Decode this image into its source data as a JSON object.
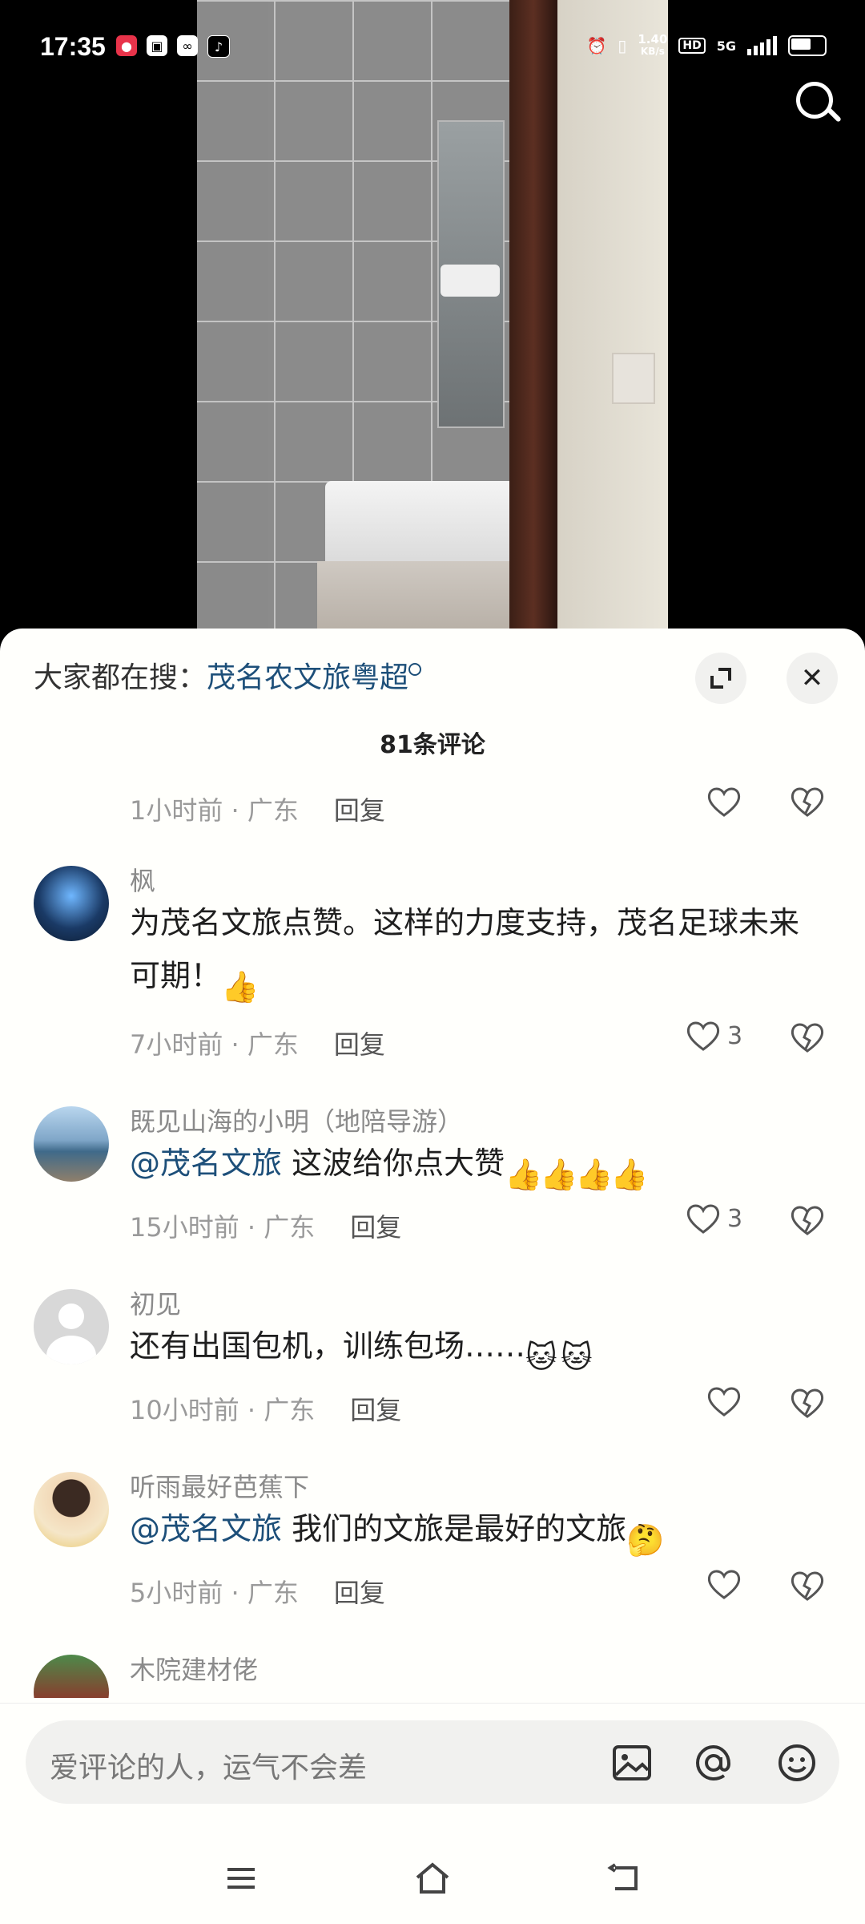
{
  "status_bar": {
    "time": "17:35",
    "net_speed_value": "1.40",
    "net_speed_unit": "KB/s",
    "hd_label": "HD",
    "network": "5G"
  },
  "hot_search": {
    "prefix": "大家都在搜：",
    "keyword": "茂名农文旅粤超"
  },
  "comments_header": {
    "count_label": "81条评论"
  },
  "reply_label": "回复",
  "comments": [
    {
      "name": "",
      "text": "",
      "meta": "1小时前 · 广东",
      "likes": ""
    },
    {
      "name": "枫",
      "text_line1": "为茂名文旅点赞。这样的力度支持，茂名足球未来",
      "text_line2": "可期！",
      "meta": "7小时前 · 广东",
      "likes": "3"
    },
    {
      "name": "既见山海的小明（地陪导游）",
      "mention": "@茂名文旅",
      "text": " 这波给你点大赞",
      "meta": "15小时前 · 广东",
      "likes": "3"
    },
    {
      "name": "初见",
      "text": "还有出国包机，训练包场……",
      "meta": "10小时前 · 广东",
      "likes": ""
    },
    {
      "name": "听雨最好芭蕉下",
      "mention": "@茂名文旅",
      "text": " 我们的文旅是最好的文旅",
      "meta": "5小时前 · 广东",
      "likes": ""
    },
    {
      "name": "木院建材佬"
    }
  ],
  "input": {
    "placeholder": "爱评论的人，运气不会差"
  },
  "icons": {
    "search": "search-icon",
    "expand": "expand-icon",
    "close": "close-icon",
    "like": "heart-icon",
    "dislike": "broken-heart-icon",
    "image": "image-icon",
    "at": "at-icon",
    "emoji": "emoji-icon"
  },
  "colors": {
    "accent_link": "#1d4f79",
    "sheet_bg": "#fffffc"
  }
}
